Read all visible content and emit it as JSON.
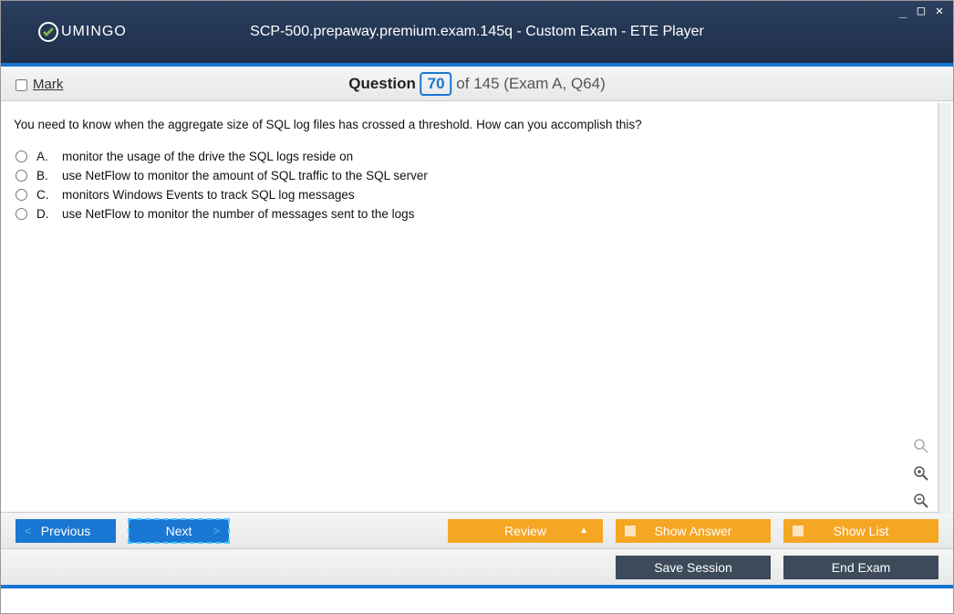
{
  "window": {
    "logo_text": "UMINGO",
    "title": "SCP-500.prepaway.premium.exam.145q - Custom Exam - ETE Player"
  },
  "question_bar": {
    "mark_label": "Mark",
    "q_label": "Question",
    "q_number": "70",
    "q_total_suffix": "of 145 (Exam A, Q64)"
  },
  "question": {
    "text": "You need to know when the aggregate size of SQL log files has crossed a threshold. How can you accomplish this?",
    "answers": [
      {
        "letter": "A.",
        "text": "monitor the usage of the drive the SQL logs reside on"
      },
      {
        "letter": "B.",
        "text": "use NetFlow to monitor the amount of SQL traffic to the SQL server"
      },
      {
        "letter": "C.",
        "text": "monitors Windows Events to track SQL log messages"
      },
      {
        "letter": "D.",
        "text": "use NetFlow to monitor the number of messages sent to the logs"
      }
    ]
  },
  "nav": {
    "previous": "Previous",
    "next": "Next",
    "review": "Review",
    "show_answer": "Show Answer",
    "show_list": "Show List"
  },
  "bottom": {
    "save_session": "Save Session",
    "end_exam": "End Exam"
  }
}
